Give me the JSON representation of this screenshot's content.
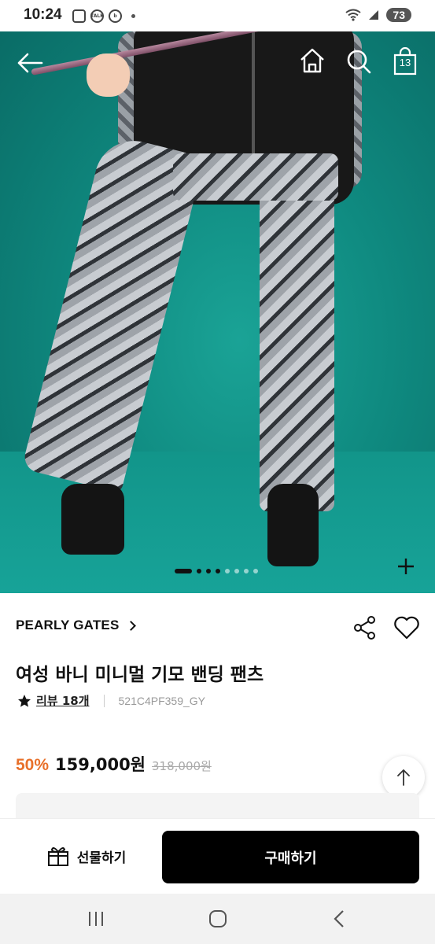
{
  "status_bar": {
    "time": "10:24",
    "battery": "73",
    "left_icons": [
      "gallery-icon",
      "talk-icon",
      "b-app-icon"
    ],
    "right_icons": [
      "wifi-icon",
      "signal-icon",
      "battery-icon"
    ]
  },
  "header": {
    "cart_count": "13",
    "icons": [
      "back-arrow-icon",
      "home-icon",
      "search-icon",
      "shopping-bag-icon"
    ]
  },
  "gallery": {
    "total_images": 8,
    "active_index": 0,
    "expand_icon": "plus-icon"
  },
  "product": {
    "brand": "PEARLY GATES",
    "title": "여성 바니 미니멀 기모 밴딩 팬츠",
    "review_label": "리뷰 18개",
    "sku": "521C4PF359_GY",
    "discount": "50%",
    "price": "159,000원",
    "original_price": "318,000원"
  },
  "actions": {
    "gift_label": "선물하기",
    "buy_label": "구매하기"
  },
  "colors": {
    "accent": "#e8702a",
    "primary_button": "#000000",
    "hero_background": "#0f8a80"
  }
}
